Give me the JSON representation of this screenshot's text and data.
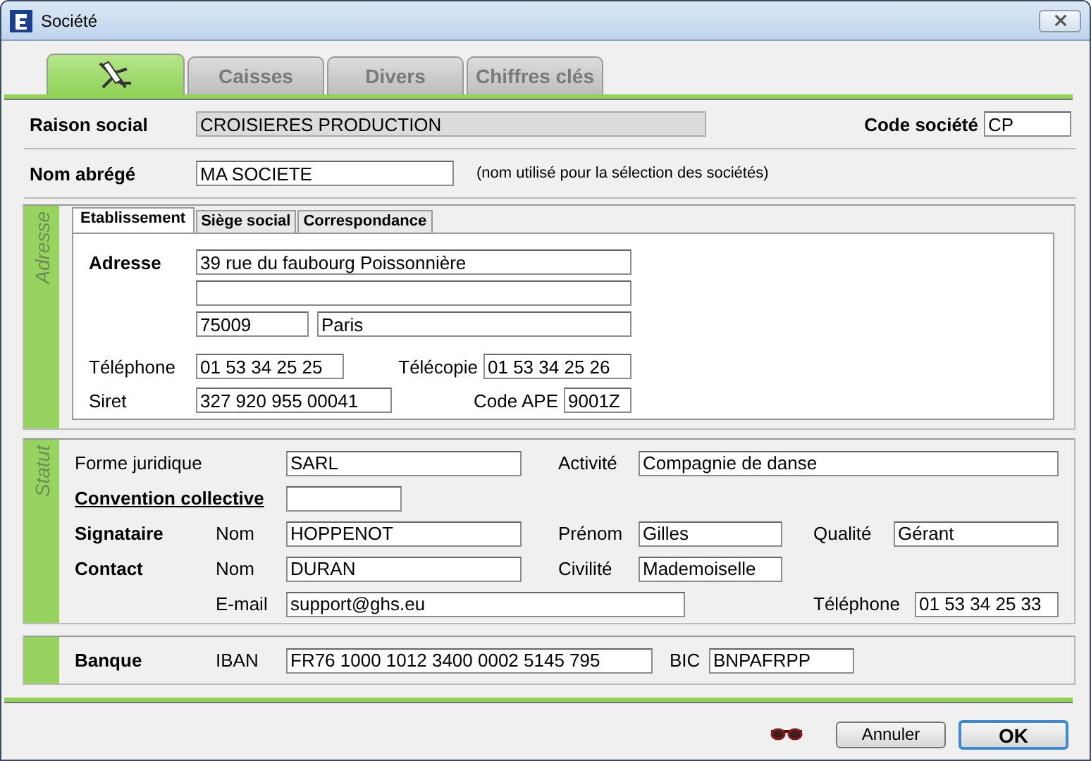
{
  "window": {
    "title": "Société"
  },
  "tabs": [
    {
      "kind": "icon",
      "selected": true
    },
    {
      "kind": "text",
      "label": "Caisses",
      "selected": false
    },
    {
      "kind": "text",
      "label": "Divers",
      "selected": false
    },
    {
      "kind": "text",
      "label": "Chiffres clés",
      "selected": false
    }
  ],
  "raison_sociale": {
    "label": "Raison social",
    "value": "CROISIERES PRODUCTION",
    "disabled": true
  },
  "code_societe": {
    "label": "Code société",
    "value": "CP"
  },
  "nom_abrege": {
    "label": "Nom abrégé",
    "value": "MA SOCIETE",
    "note": "(nom utilisé pour la sélection des sociétés)"
  },
  "adresse": {
    "side_label": "Adresse",
    "subtabs": [
      {
        "label": "Etablissement",
        "selected": true
      },
      {
        "label": "Siège social",
        "selected": false
      },
      {
        "label": "Correspondance",
        "selected": false
      }
    ],
    "label": "Adresse",
    "lines": [
      "39 rue du faubourg Poissonnière"
    ],
    "code_postal": "75009",
    "ville": "Paris",
    "telephone": {
      "label": "Téléphone",
      "value": "01 53 34 25 25"
    },
    "telecopie": {
      "label": "Télécopie",
      "value": "01 53 34 25 26"
    },
    "siret": {
      "label": "Siret",
      "value": "327 920 955 00041"
    },
    "code_ape": {
      "label": "Code APE",
      "value": "9001Z"
    }
  },
  "statut": {
    "side_label": "Statut",
    "forme_juridique": {
      "label": "Forme juridique",
      "value": "SARL"
    },
    "activite": {
      "label": "Activité",
      "value": "Compagnie de danse"
    },
    "convention_collective": {
      "label": "Convention collective"
    },
    "signataire": {
      "label": "Signataire",
      "nom": {
        "label": "Nom",
        "value": "HOPPENOT"
      },
      "prenom": {
        "label": "Prénom",
        "value": "Gilles"
      },
      "qualite": {
        "label": "Qualité",
        "value": "Gérant"
      }
    },
    "contact": {
      "label": "Contact",
      "nom": {
        "label": "Nom",
        "value": "DURAN"
      },
      "civilite": {
        "label": "Civilité",
        "value": "Mademoiselle"
      },
      "email": {
        "label": "E-mail",
        "value": "support@ghs.eu"
      },
      "telephone": {
        "label": "Téléphone",
        "value": "01 53 34 25 33"
      }
    }
  },
  "banque": {
    "label": "Banque",
    "iban": {
      "label": "IBAN",
      "value": "FR76 1000 1012 3400 0002 5145 795"
    },
    "bic": {
      "label": "BIC",
      "value": "BNPAFRPP"
    }
  },
  "buttons": [
    {
      "label": "Annuler",
      "kind": "normal"
    },
    {
      "label": "OK",
      "kind": "default"
    }
  ]
}
